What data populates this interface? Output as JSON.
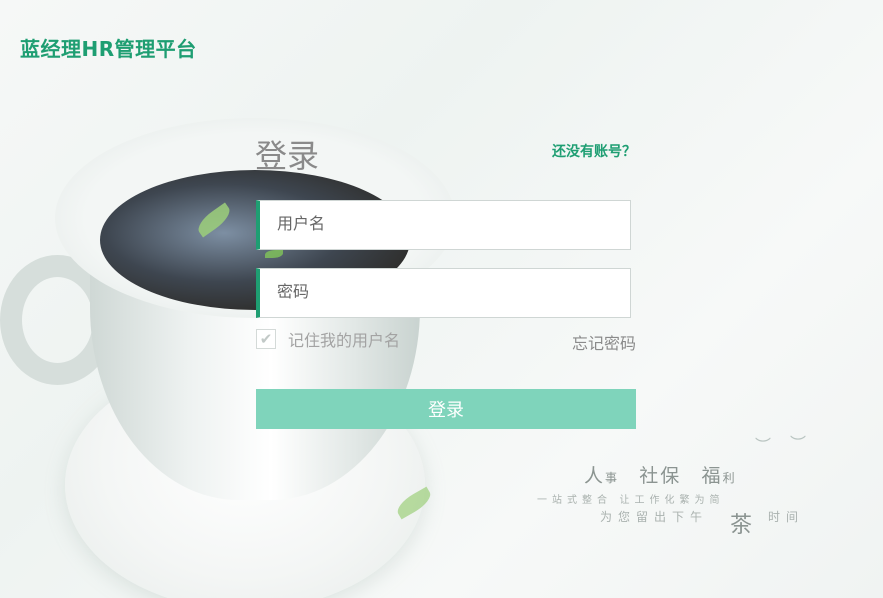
{
  "brand": {
    "title": "蓝经理HR管理平台"
  },
  "login": {
    "title": "登录",
    "register_link": "还没有账号？",
    "username_placeholder": "用户名",
    "password_placeholder": "密码",
    "remember_label": "记住我的用户名",
    "remember_checked": true,
    "forgot_link": "忘记密码",
    "submit_label": "登录"
  },
  "slogan": {
    "word1": "人",
    "word1_small": "事",
    "word2": "社保",
    "word3": "福",
    "word3_small": "利",
    "line1": "一站式整合 让工作化繁为简",
    "line2": "为您留出下午",
    "tea": "茶",
    "line2_tail": "时间"
  },
  "colors": {
    "accent": "#1e9e72",
    "button": "#7fd4bb"
  },
  "icons": {
    "checkbox_mark": "check-icon"
  }
}
